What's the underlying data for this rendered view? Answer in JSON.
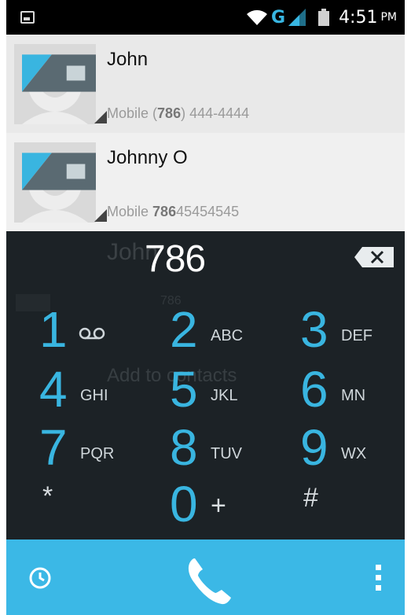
{
  "status_bar": {
    "network": "G",
    "time": "4:51",
    "ampm": "PM"
  },
  "contacts": [
    {
      "name": "John",
      "label": "Mobile",
      "number_prefix": "(",
      "number_match": "786",
      "number_rest": ") 444-4444"
    },
    {
      "name": "Johnny O",
      "label": "Mobile",
      "number_prefix": "",
      "number_match": "786",
      "number_rest": "45454545"
    }
  ],
  "ghost": {
    "name": "John",
    "number": "786",
    "add_contacts": "Add to contacts"
  },
  "dialer": {
    "digits": "786",
    "keys": [
      {
        "num": "1",
        "letters": ""
      },
      {
        "num": "2",
        "letters": "ABC"
      },
      {
        "num": "3",
        "letters": "DEF"
      },
      {
        "num": "4",
        "letters": "GHI"
      },
      {
        "num": "5",
        "letters": "JKL"
      },
      {
        "num": "6",
        "letters": "MN"
      },
      {
        "num": "7",
        "letters": "PQR"
      },
      {
        "num": "8",
        "letters": "TUV"
      },
      {
        "num": "9",
        "letters": "WX"
      },
      {
        "num": "*",
        "letters": ""
      },
      {
        "num": "0",
        "letters": "+"
      },
      {
        "num": "#",
        "letters": ""
      }
    ]
  },
  "colors": {
    "accent": "#39b5e0",
    "dialpad_bg": "#1c2226",
    "action_bar": "#3bb8e6"
  }
}
